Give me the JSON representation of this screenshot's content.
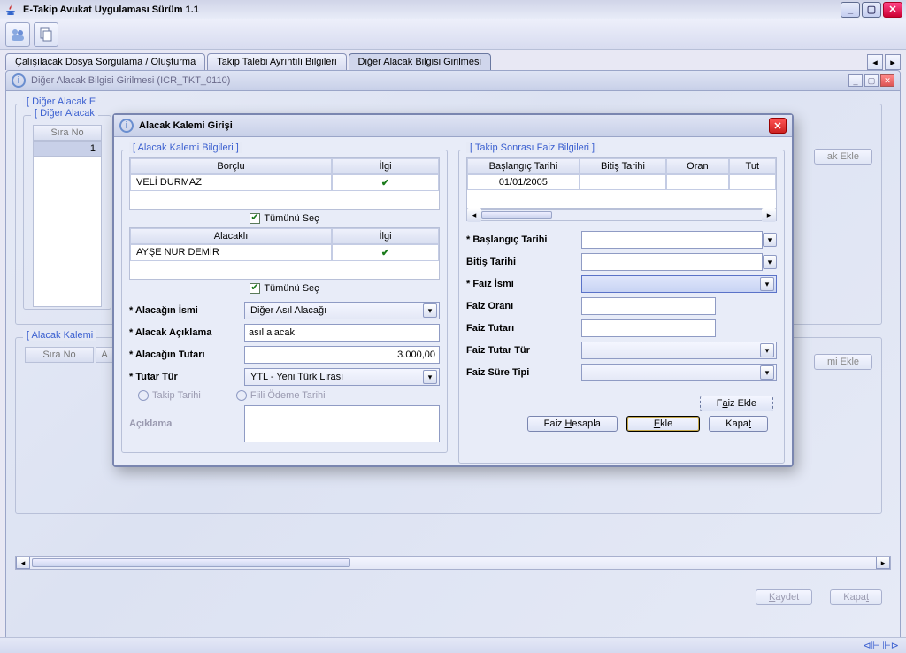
{
  "window": {
    "title": "E-Takip Avukat Uygulaması Sürüm 1.1"
  },
  "tabs": [
    {
      "label": "Çalışılacak Dosya Sorgulama / Oluşturma"
    },
    {
      "label": "Takip Talebi Ayrıntılı Bilgileri"
    },
    {
      "label": "Diğer Alacak Bilgisi Girilmesi"
    }
  ],
  "inner_header": "Diğer Alacak Bilgisi Girilmesi (ICR_TKT_0110)",
  "bg": {
    "box1_legend": "[ Diğer Alacak E",
    "box1_inner_legend": "[ Diğer Alacak",
    "col_sira": "Sıra No",
    "row1_sira": "1",
    "btn_ak_ekle": "ak Ekle",
    "box2_legend": "[ Alacak Kalemi",
    "btn_mi_ekle": "mi Ekle",
    "col_a": "A"
  },
  "dialog": {
    "title": "Alacak Kalemi Girişi",
    "left": {
      "legend": "[ Alacak Kalemi Bilgileri ]",
      "borclu_hdr": "Borçlu",
      "ilgi_hdr": "İlgi",
      "borclu_name": "VELİ DURMAZ",
      "tumunu_sec": "Tümünü Seç",
      "alacakli_hdr": "Alacaklı",
      "alacakli_name": "AYŞE NUR DEMİR",
      "lbl_alacagin_ismi": "* Alacağın İsmi",
      "val_alacagin_ismi": "Diğer Asıl Alacağı",
      "lbl_alacak_aciklama": "* Alacak Açıklama",
      "val_alacak_aciklama": "asıl alacak",
      "lbl_alacagin_tutari": "* Alacağın Tutarı",
      "val_alacagin_tutari": "3.000,00",
      "lbl_tutar_tur": "* Tutar Tür",
      "val_tutar_tur": "YTL - Yeni Türk Lirası",
      "radio_takip": "Takip Tarihi",
      "radio_fiili": "Fiili Ödeme Tarihi",
      "lbl_aciklama": "Açıklama"
    },
    "right": {
      "legend": "[ Takip Sonrası Faiz Bilgileri ]",
      "hdr_baslangic": "Başlangıç Tarihi",
      "hdr_bitis": "Bitiş Tarihi",
      "hdr_oran": "Oran",
      "hdr_tut": "Tut",
      "row_date": "01/01/2005",
      "lbl_baslangic": "* Başlangıç Tarihi",
      "lbl_bitis": "Bitiş Tarihi",
      "lbl_faiz_ismi": "* Faiz İsmi",
      "lbl_faiz_orani": "Faiz Oranı",
      "lbl_faiz_tutari": "Faiz Tutarı",
      "lbl_faiz_tutar_tur": "Faiz Tutar Tür",
      "lbl_faiz_sure": "Faiz Süre Tipi",
      "btn_faiz_ekle_pre": "F",
      "btn_faiz_ekle_u": "a",
      "btn_faiz_ekle_post": "iz Ekle",
      "btn_faiz_hesapla_pre": "Faiz ",
      "btn_faiz_hesapla_u": "H",
      "btn_faiz_hesapla_post": "esapla",
      "btn_ekle_u": "E",
      "btn_ekle_post": "kle",
      "btn_kapat_pre": "Kapa",
      "btn_kapat_u": "t"
    }
  },
  "footer": {
    "kaydet_u": "K",
    "kaydet_post": "aydet",
    "kapat_pre": "Kapa",
    "kapat_u": "t"
  }
}
